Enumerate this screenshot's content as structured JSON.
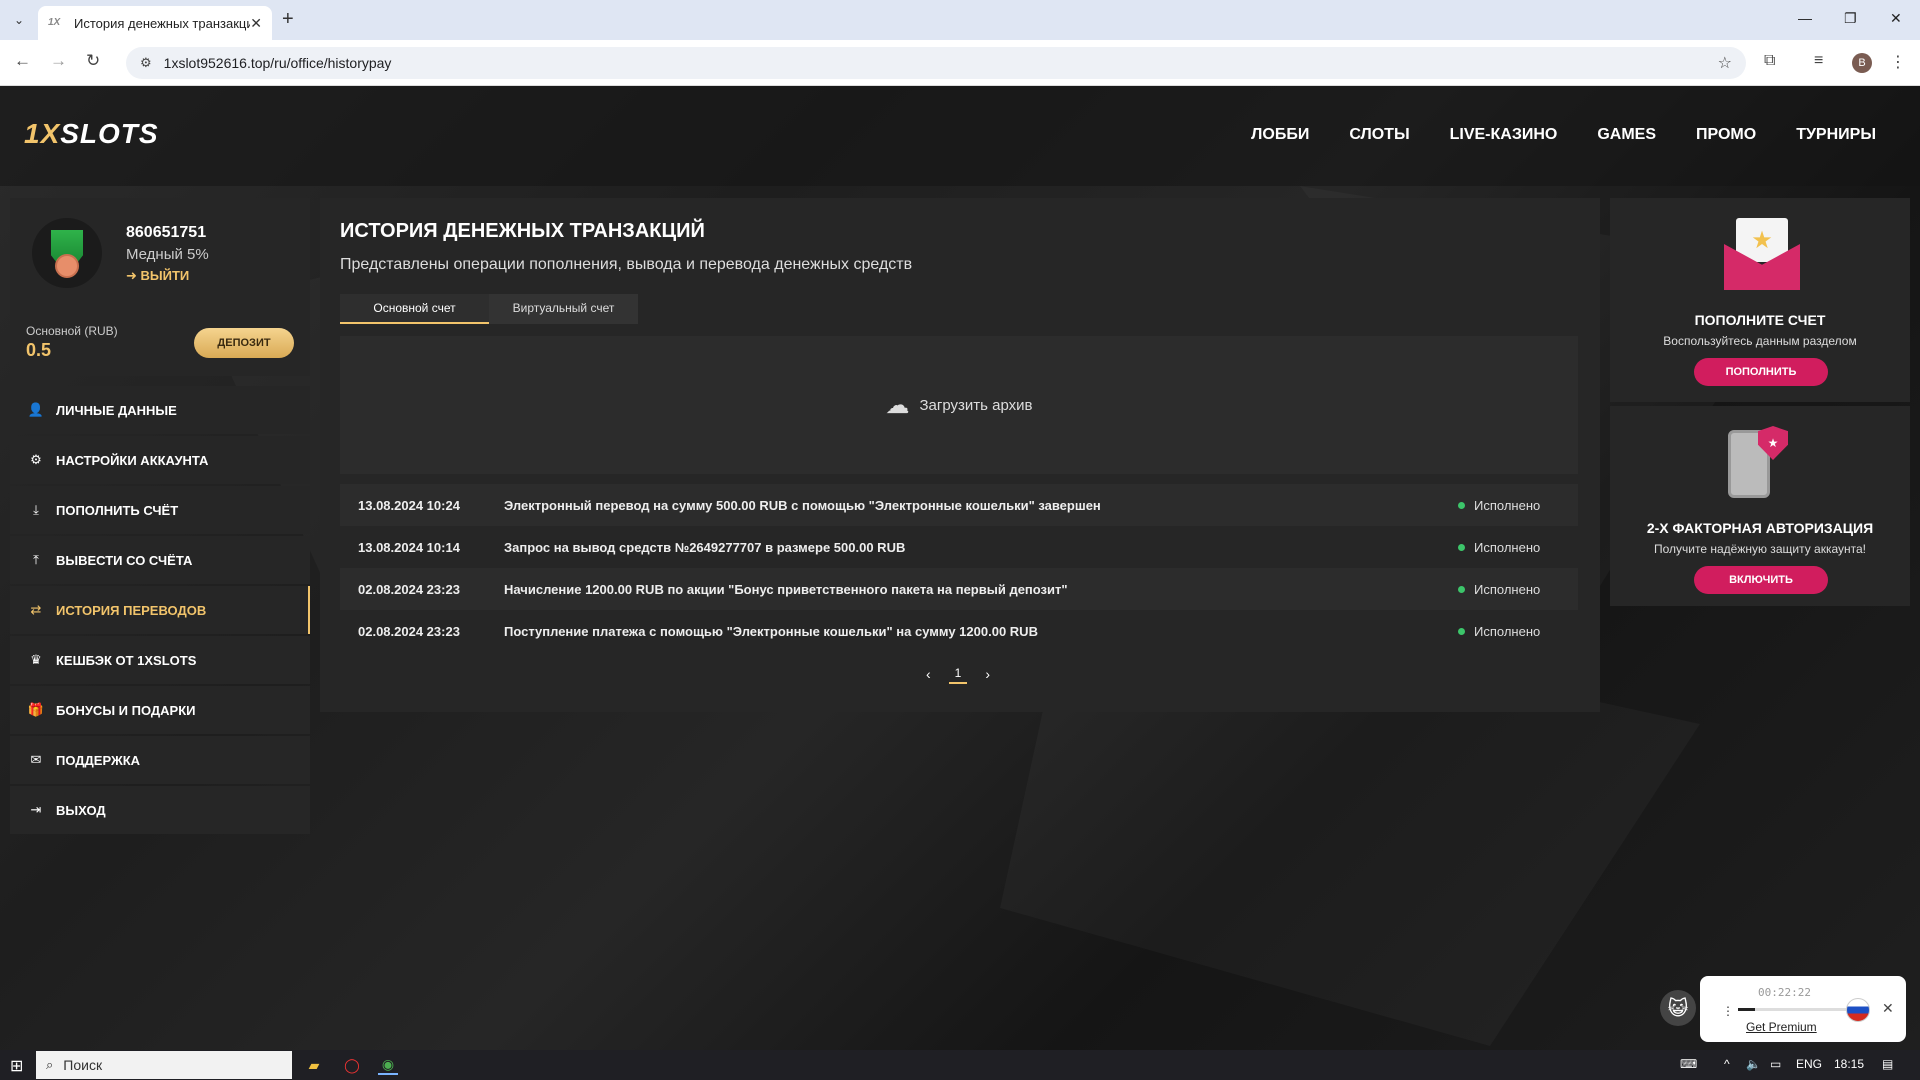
{
  "browser": {
    "tab_title": "История денежных транзакций",
    "tab_favicon": "1X",
    "url": "1xslot952616.top/ru/office/historypay",
    "profile_initial": "B"
  },
  "site": {
    "logo_part1": "1X",
    "logo_part2": "SLOTS",
    "nav": [
      "ЛОББИ",
      "СЛОТЫ",
      "LIVE-КАЗИНО",
      "GAMES",
      "ПРОМО",
      "ТУРНИРЫ"
    ]
  },
  "user": {
    "id": "860651751",
    "level": "Медный 5%",
    "logout": "ВЫЙТИ",
    "balance_label": "Основной (RUB)",
    "balance": "0.5",
    "deposit_label": "ДЕПОЗИТ"
  },
  "menu": [
    {
      "label": "ЛИЧНЫЕ ДАННЫЕ",
      "icon": "user-gear-icon"
    },
    {
      "label": "НАСТРОЙКИ АККАУНТА",
      "icon": "settings-icon"
    },
    {
      "label": "ПОПОЛНИТЬ СЧЁТ",
      "icon": "download-icon"
    },
    {
      "label": "ВЫВЕСТИ СО СЧЁТА",
      "icon": "upload-icon"
    },
    {
      "label": "ИСТОРИЯ ПЕРЕВОДОВ",
      "icon": "transfer-icon"
    },
    {
      "label": "КЕШБЭК ОТ 1XSLOTS",
      "icon": "crown-icon"
    },
    {
      "label": "БОНУСЫ И ПОДАРКИ",
      "icon": "gift-icon"
    },
    {
      "label": "ПОДДЕРЖКА",
      "icon": "mail-icon"
    },
    {
      "label": "ВЫХОД",
      "icon": "exit-icon"
    }
  ],
  "main": {
    "title": "ИСТОРИЯ ДЕНЕЖНЫХ ТРАНЗАКЦИЙ",
    "subtitle": "Представлены операции пополнения, вывода и перевода денежных средств",
    "tabs": [
      "Основной счет",
      "Виртуальный счет"
    ],
    "archive_label": "Загрузить архив",
    "transactions": [
      {
        "date": "13.08.2024 10:24",
        "desc": "Электронный перевод на сумму 500.00 RUB с помощью \"Электронные кошельки\" завершен",
        "status": "Исполнено"
      },
      {
        "date": "13.08.2024 10:14",
        "desc": "Запрос на вывод средств №2649277707 в размере 500.00 RUB",
        "status": "Исполнено"
      },
      {
        "date": "02.08.2024 23:23",
        "desc": "Начисление 1200.00 RUB по акции \"Бонус приветственного пакета на первый депозит\"",
        "status": "Исполнено"
      },
      {
        "date": "02.08.2024 23:23",
        "desc": "Поступление платежа с помощью \"Электронные кошельки\" на сумму 1200.00 RUB",
        "status": "Исполнено"
      }
    ],
    "page": "1"
  },
  "promo1": {
    "title": "ПОПОЛНИТЕ СЧЕТ",
    "subtitle": "Воспользуйтесь данным разделом",
    "button": "ПОПОЛНИТЬ"
  },
  "promo2": {
    "title": "2-Х ФАКТОРНАЯ АВТОРИЗАЦИЯ",
    "subtitle": "Получите надёжную защиту аккаунта!",
    "button": "ВКЛЮЧИТЬ"
  },
  "widget": {
    "time": "00:22:22",
    "link": "Get Premium",
    "progress": 0.15
  },
  "taskbar": {
    "search": "Поиск",
    "lang": "ENG",
    "clock": "18:15"
  },
  "colors": {
    "accent_gold": "#f2c46b",
    "promo_pink": "#d11d5e",
    "status_green": "#3cc56a"
  }
}
